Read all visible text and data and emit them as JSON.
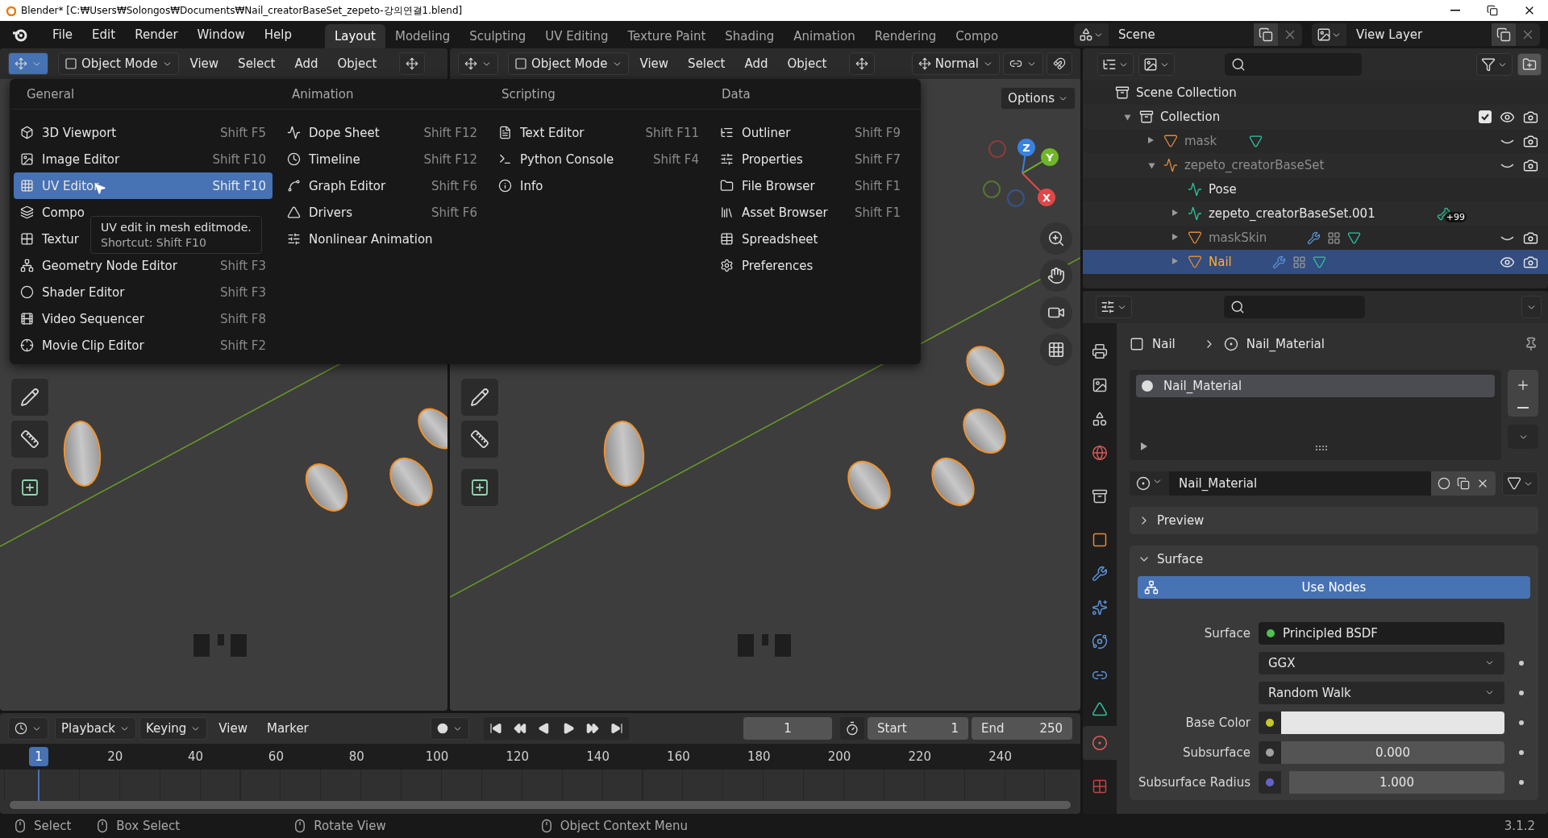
{
  "title_bar": {
    "title": "Blender* [C:₩Users₩Solongos₩Documents₩Nail_creatorBaseSet_zepeto-강의연결1.blend]"
  },
  "top_bar": {
    "menus": [
      "File",
      "Edit",
      "Render",
      "Window",
      "Help"
    ],
    "workspaces": [
      {
        "label": "Layout",
        "selected": true
      },
      {
        "label": "Modeling",
        "selected": false
      },
      {
        "label": "Sculpting",
        "selected": false
      },
      {
        "label": "UV Editing",
        "selected": false
      },
      {
        "label": "Texture Paint",
        "selected": false
      },
      {
        "label": "Shading",
        "selected": false
      },
      {
        "label": "Animation",
        "selected": false
      },
      {
        "label": "Rendering",
        "selected": false
      },
      {
        "label": "Compo",
        "selected": false
      }
    ],
    "scene": "Scene",
    "view_layer": "View Layer"
  },
  "viewports": [
    {
      "mode": "Object Mode",
      "menus": [
        "View",
        "Select",
        "Add",
        "Object"
      ]
    },
    {
      "mode": "Object Mode",
      "menus": [
        "View",
        "Select",
        "Add",
        "Object"
      ],
      "orientation": "Normal",
      "options": "Options",
      "gizmo_axes": [
        "X",
        "Y",
        "Z"
      ]
    }
  ],
  "editor_menu": {
    "columns": [
      {
        "heading": "General",
        "items": [
          {
            "label": "3D Viewport",
            "shortcut": "Shift F5",
            "selected": false
          },
          {
            "label": "Image Editor",
            "shortcut": "Shift F10",
            "selected": false
          },
          {
            "label": "UV Editor",
            "shortcut": "Shift F10",
            "selected": true
          },
          {
            "label": "Compo",
            "selected": false
          },
          {
            "label": "Textur",
            "selected": false
          },
          {
            "label": "Geometry Node Editor",
            "shortcut": "Shift F3",
            "selected": false
          },
          {
            "label": "Shader Editor",
            "shortcut": "Shift F3",
            "selected": false
          },
          {
            "label": "Video Sequencer",
            "shortcut": "Shift F8",
            "selected": false
          },
          {
            "label": "Movie Clip Editor",
            "shortcut": "Shift F2",
            "selected": false
          }
        ]
      },
      {
        "heading": "Animation",
        "items": [
          {
            "label": "Dope Sheet",
            "shortcut": "Shift F12",
            "selected": false
          },
          {
            "label": "Timeline",
            "shortcut": "Shift F12",
            "selected": false
          },
          {
            "label": "Graph Editor",
            "shortcut": "Shift F6",
            "selected": false
          },
          {
            "label": "Drivers",
            "shortcut": "Shift F6",
            "selected": false
          },
          {
            "label": "Nonlinear Animation",
            "selected": false
          }
        ]
      },
      {
        "heading": "Scripting",
        "items": [
          {
            "label": "Text Editor",
            "shortcut": "Shift F11",
            "selected": false
          },
          {
            "label": "Python Console",
            "shortcut": "Shift F4",
            "selected": false
          },
          {
            "label": "Info",
            "selected": false
          }
        ]
      },
      {
        "heading": "Data",
        "items": [
          {
            "label": "Outliner",
            "shortcut": "Shift F9",
            "selected": false
          },
          {
            "label": "Properties",
            "shortcut": "Shift F7",
            "selected": false
          },
          {
            "label": "File Browser",
            "shortcut": "Shift F1",
            "selected": false
          },
          {
            "label": "Asset Browser",
            "shortcut": "Shift F1",
            "selected": false
          },
          {
            "label": "Spreadsheet",
            "selected": false
          },
          {
            "label": "Preferences",
            "selected": false
          }
        ]
      }
    ],
    "tooltip": {
      "description": "UV edit in mesh editmode.",
      "shortcut": "Shortcut: Shift F10"
    }
  },
  "timeline": {
    "dropdowns": [
      "Playback",
      "Keying"
    ],
    "menus": [
      "View",
      "Marker"
    ],
    "current_frame": "1",
    "start": {
      "label": "Start",
      "value": "1"
    },
    "end": {
      "label": "End",
      "value": "250"
    },
    "ruler": {
      "current": "1",
      "ticks": [
        "20",
        "40",
        "60",
        "80",
        "100",
        "120",
        "140",
        "160",
        "180",
        "200",
        "220",
        "240"
      ]
    }
  },
  "outliner": {
    "tree": [
      {
        "label": "Scene Collection",
        "kind": "scene_collection",
        "selected": false,
        "children": [
          {
            "label": "Collection",
            "kind": "collection",
            "selected": false,
            "expanded": true,
            "checked": true,
            "visible": true,
            "children": [
              {
                "label": "mask",
                "kind": "mesh",
                "selected": false,
                "expanded": false,
                "visible": false,
                "modifiers": false
              },
              {
                "label": "zepeto_creatorBaseSet",
                "kind": "armature",
                "selected": false,
                "expanded": true,
                "visible": false,
                "children": [
                  {
                    "label": "Pose",
                    "kind": "pose",
                    "selected": false
                  },
                  {
                    "label": "zepeto_creatorBaseSet.001",
                    "kind": "pose",
                    "selected": false,
                    "expanded": false,
                    "bone_badge": "+99"
                  },
                  {
                    "label": "maskSkin",
                    "kind": "mesh",
                    "selected": false,
                    "expanded": false,
                    "visible": false,
                    "modifiers": true
                  },
                  {
                    "label": "Nail",
                    "kind": "mesh",
                    "selected": true,
                    "expanded": false,
                    "visible": true,
                    "modifiers": true
                  }
                ]
              }
            ]
          }
        ]
      }
    ]
  },
  "properties": {
    "tabs": [
      {
        "kind": "output",
        "selected": false
      },
      {
        "kind": "view_layer",
        "selected": false
      },
      {
        "kind": "scene",
        "selected": false
      },
      {
        "kind": "world",
        "selected": false
      },
      {
        "kind": "collection",
        "selected": false
      },
      {
        "kind": "object",
        "selected": false
      },
      {
        "kind": "modifiers",
        "selected": false
      },
      {
        "kind": "particles",
        "selected": false
      },
      {
        "kind": "physics",
        "selected": false
      },
      {
        "kind": "constraints",
        "selected": false
      },
      {
        "kind": "data",
        "selected": false
      },
      {
        "kind": "material",
        "selected": true
      },
      {
        "kind": "texture",
        "selected": false
      }
    ],
    "breadcrumb": {
      "object": "Nail",
      "material": "Nail_Material"
    },
    "slots": [
      {
        "label": "Nail_Material",
        "selected": true
      }
    ],
    "datablock": "Nail_Material",
    "panels": [
      {
        "title": "Preview",
        "expanded": false
      },
      {
        "title": "Surface",
        "expanded": true,
        "button": "Use Nodes",
        "rows": [
          {
            "kind": "link",
            "label": "Surface",
            "value": "Principled BSDF",
            "color": "#4fc14f"
          },
          {
            "kind": "dropdown",
            "value": "GGX"
          },
          {
            "kind": "dropdown",
            "value": "Random Walk"
          },
          {
            "kind": "color",
            "label": "Base Color",
            "color": "#c7c72e"
          },
          {
            "kind": "number",
            "label": "Subsurface",
            "value": "0.000",
            "color": "#a1a1a1"
          },
          {
            "kind": "vector",
            "label": "Subsurface Radius",
            "value": "1.000",
            "color": "#6363c7"
          }
        ]
      }
    ]
  },
  "status_bar": {
    "hints": [
      "Select",
      "Box Select",
      "Rotate View",
      "Object Context Menu"
    ],
    "version": "3.1.2"
  }
}
